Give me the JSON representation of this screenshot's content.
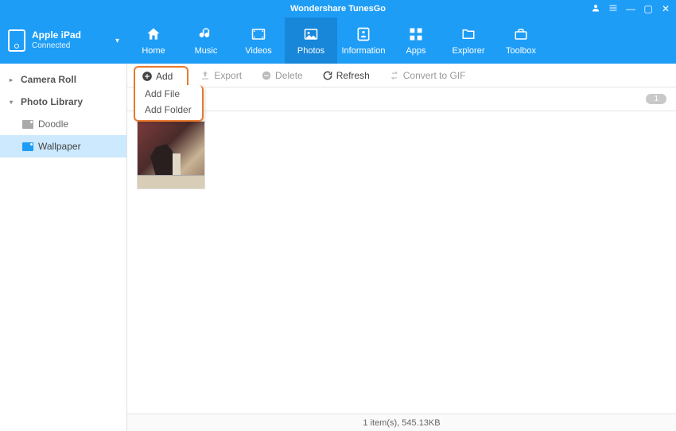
{
  "app_title": "Wondershare TunesGo",
  "device": {
    "name": "Apple iPad",
    "status": "Connected"
  },
  "nav": [
    {
      "label": "Home"
    },
    {
      "label": "Music"
    },
    {
      "label": "Videos"
    },
    {
      "label": "Photos"
    },
    {
      "label": "Information"
    },
    {
      "label": "Apps"
    },
    {
      "label": "Explorer"
    },
    {
      "label": "Toolbox"
    }
  ],
  "sidebar": {
    "camera_roll": "Camera Roll",
    "photo_library": "Photo Library",
    "children": [
      {
        "label": "Doodle"
      },
      {
        "label": "Wallpaper"
      }
    ]
  },
  "toolbar": {
    "add": "Add",
    "export": "Export",
    "delete": "Delete",
    "refresh": "Refresh",
    "gif": "Convert to GIF",
    "dropdown": {
      "add_file": "Add File",
      "add_folder": "Add Folder"
    }
  },
  "breadcrumb": {
    "count_badge": "1"
  },
  "status": "1 item(s), 545.13KB"
}
